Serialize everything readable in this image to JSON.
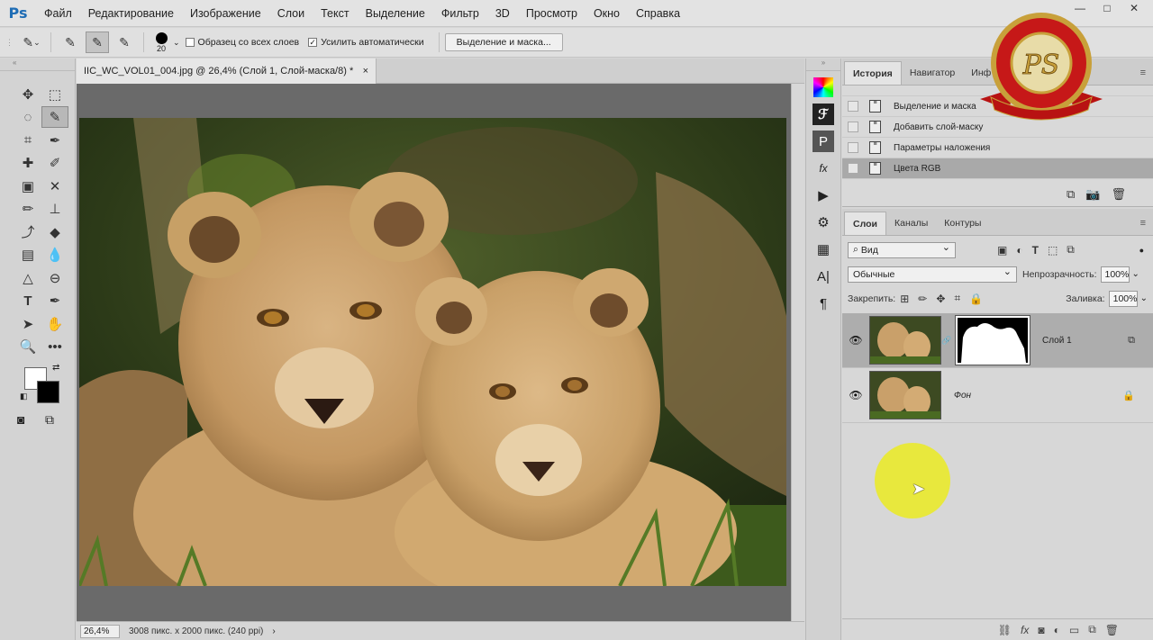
{
  "app": {
    "logo": "Ps"
  },
  "menu": [
    "Файл",
    "Редактирование",
    "Изображение",
    "Слои",
    "Текст",
    "Выделение",
    "Фильтр",
    "3D",
    "Просмотр",
    "Окно",
    "Справка"
  ],
  "window_controls": [
    "—",
    "□",
    "✕"
  ],
  "options": {
    "brush_size": "20",
    "sample_all_layers": "Образец со всех слоев",
    "sample_all_layers_checked": false,
    "auto_enhance": "Усилить автоматически",
    "auto_enhance_checked": true,
    "refine_button": "Выделение и маска..."
  },
  "document": {
    "tab_title": "IIC_WC_VOL01_004.jpg @ 26,4% (Слой 1, Слой-маска/8) *",
    "close": "×",
    "zoom": "26,4%",
    "info": "3008 пикс. x 2000 пикс. (240 ppi)",
    "status_arrow": "›"
  },
  "history_panel": {
    "tabs": [
      "История",
      "Навигатор",
      "Инф"
    ],
    "active_tab": "История",
    "items": [
      "Выделение и маска",
      "Добавить слой-маску",
      "Параметры наложения",
      "Цвета RGB"
    ],
    "selected_item": "Цвета RGB"
  },
  "layers_panel": {
    "tabs": [
      "Слои",
      "Каналы",
      "Контуры"
    ],
    "active_tab": "Слои",
    "filter_label": "Вид",
    "blend_mode": "Обычные",
    "opacity_label": "Непрозрачность:",
    "opacity_value": "100%",
    "lock_label": "Закрепить:",
    "fill_label": "Заливка:",
    "fill_value": "100%",
    "layers": [
      {
        "name": "Слой 1",
        "has_mask": true,
        "selected": true
      },
      {
        "name": "Фон",
        "locked": true,
        "selected": false
      }
    ]
  },
  "badge": {
    "text": "PS"
  },
  "colors": {
    "ui_bg": "#d6d6d6",
    "canvas_bg": "#6a6a6a",
    "ps_blue": "#1f6db5",
    "cursor_highlight": "#eaea2c",
    "selected_row": "#a9a9a9"
  }
}
